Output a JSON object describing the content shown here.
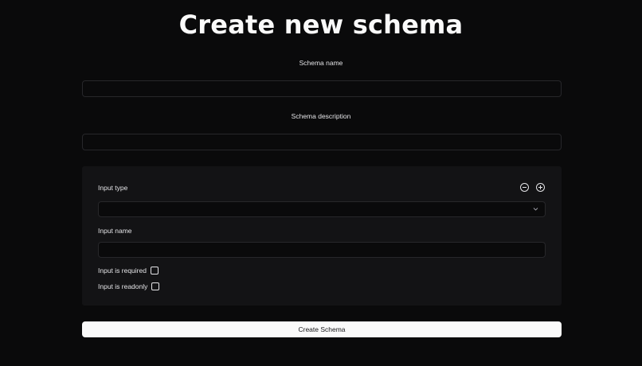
{
  "page": {
    "title": "Create new schema"
  },
  "schema_name": {
    "label": "Schema name",
    "value": "",
    "placeholder": ""
  },
  "schema_description": {
    "label": "Schema description",
    "value": "",
    "placeholder": ""
  },
  "input_block": {
    "type_label": "Input type",
    "type_selected": "",
    "remove_icon": "minus-circle-icon",
    "add_icon": "plus-circle-icon",
    "name_label": "Input name",
    "name_value": "",
    "required_label": "Input is required",
    "required_checked": false,
    "readonly_label": "Input is readonly",
    "readonly_checked": false
  },
  "submit": {
    "label": "Create Schema"
  },
  "colors": {
    "background": "#0a0a0b",
    "panel": "#131315",
    "border": "#27272a",
    "text": "#fafafa",
    "button_bg": "#fafafa",
    "button_text": "#18181b"
  }
}
